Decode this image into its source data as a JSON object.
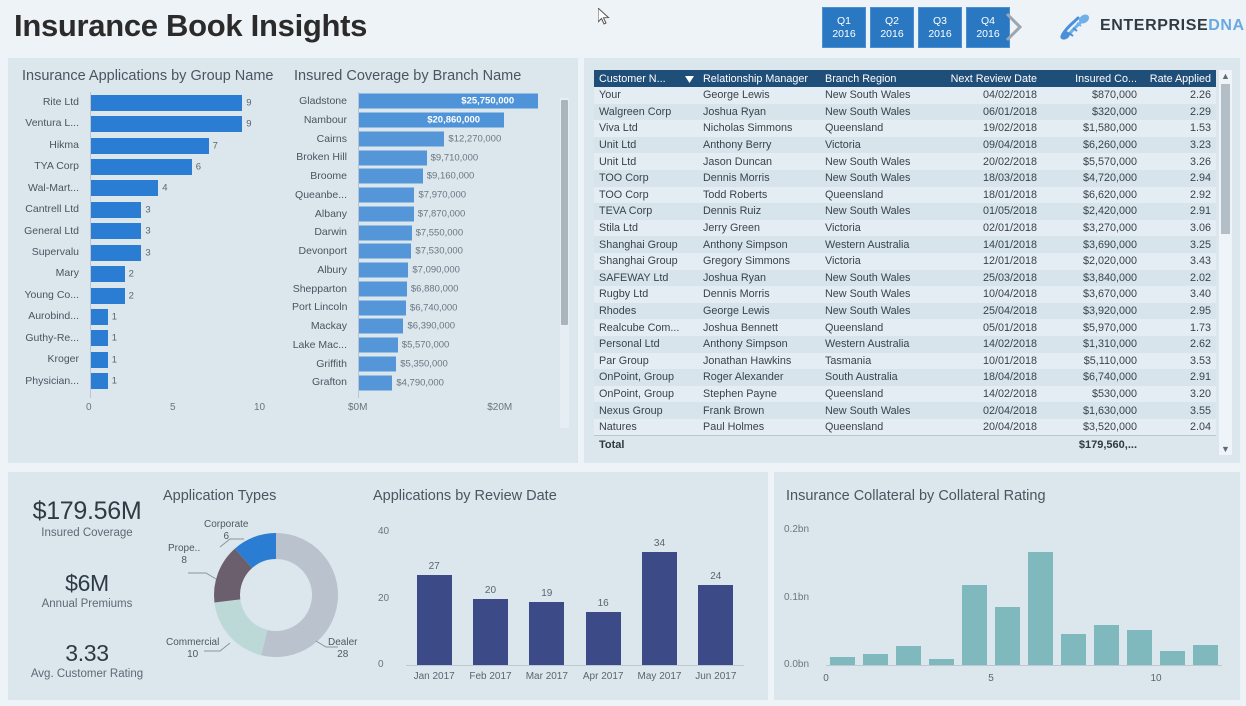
{
  "header": {
    "title": "Insurance Book Insights",
    "quarters": [
      {
        "q": "Q1",
        "year": "2016"
      },
      {
        "q": "Q2",
        "year": "2016"
      },
      {
        "q": "Q3",
        "year": "2016"
      },
      {
        "q": "Q4",
        "year": "2016"
      }
    ],
    "next_arrow": "next-quarter-arrow",
    "brand_primary": "ENTERPRISE",
    "brand_secondary": "DNA",
    "brand_color": "#69a8e0",
    "accent_color": "#2b78c2"
  },
  "panels": {
    "applications_title": "Insurance Applications by Group Name",
    "coverage_title": "Insured Coverage by Branch Name",
    "app_types_title": "Application Types",
    "review_date_title": "Applications by Review Date",
    "collateral_title": "Insurance Collateral by Collateral Rating"
  },
  "kpis": [
    {
      "value": "$179.56M",
      "label": "Insured Coverage"
    },
    {
      "value": "$6M",
      "label": "Annual Premiums"
    },
    {
      "value": "3.33",
      "label": "Avg. Customer Rating"
    }
  ],
  "table": {
    "headers": [
      "Customer N...",
      "Relationship Manager",
      "Branch Region",
      "Next Review Date",
      "Insured Co...",
      "Rate Applied"
    ],
    "sort_indicator": "sort-descending-icon",
    "rows": [
      [
        "Your",
        "George Lewis",
        "New South Wales",
        "04/02/2018",
        "$870,000",
        "2.26"
      ],
      [
        "Walgreen Corp",
        "Joshua Ryan",
        "New South Wales",
        "06/01/2018",
        "$320,000",
        "2.29"
      ],
      [
        "Viva Ltd",
        "Nicholas Simmons",
        "Queensland",
        "19/02/2018",
        "$1,580,000",
        "1.53"
      ],
      [
        "Unit Ltd",
        "Anthony Berry",
        "Victoria",
        "09/04/2018",
        "$6,260,000",
        "3.23"
      ],
      [
        "Unit Ltd",
        "Jason Duncan",
        "New South Wales",
        "20/02/2018",
        "$5,570,000",
        "3.26"
      ],
      [
        "TOO Corp",
        "Dennis Morris",
        "New South Wales",
        "18/03/2018",
        "$4,720,000",
        "2.94"
      ],
      [
        "TOO Corp",
        "Todd Roberts",
        "Queensland",
        "18/01/2018",
        "$6,620,000",
        "2.92"
      ],
      [
        "TEVA Corp",
        "Dennis Ruiz",
        "New South Wales",
        "01/05/2018",
        "$2,420,000",
        "2.91"
      ],
      [
        "Stila Ltd",
        "Jerry Green",
        "Victoria",
        "02/01/2018",
        "$3,270,000",
        "3.06"
      ],
      [
        "Shanghai Group",
        "Anthony Simpson",
        "Western Australia",
        "14/01/2018",
        "$3,690,000",
        "3.25"
      ],
      [
        "Shanghai Group",
        "Gregory Simmons",
        "Victoria",
        "12/01/2018",
        "$2,020,000",
        "3.43"
      ],
      [
        "SAFEWAY Ltd",
        "Joshua Ryan",
        "New South Wales",
        "25/03/2018",
        "$3,840,000",
        "2.02"
      ],
      [
        "Rugby Ltd",
        "Dennis Morris",
        "New South Wales",
        "10/04/2018",
        "$3,670,000",
        "3.40"
      ],
      [
        "Rhodes",
        "George Lewis",
        "New South Wales",
        "25/04/2018",
        "$3,920,000",
        "2.95"
      ],
      [
        "Realcube Com...",
        "Joshua Bennett",
        "Queensland",
        "05/01/2018",
        "$5,970,000",
        "1.73"
      ],
      [
        "Personal Ltd",
        "Anthony Simpson",
        "Western Australia",
        "14/02/2018",
        "$1,310,000",
        "2.62"
      ],
      [
        "Par Group",
        "Jonathan Hawkins",
        "Tasmania",
        "10/01/2018",
        "$5,110,000",
        "3.53"
      ],
      [
        "OnPoint, Group",
        "Roger Alexander",
        "South Australia",
        "18/04/2018",
        "$6,740,000",
        "2.91"
      ],
      [
        "OnPoint, Group",
        "Stephen Payne",
        "Queensland",
        "14/02/2018",
        "$530,000",
        "3.20"
      ],
      [
        "Nexus Group",
        "Frank Brown",
        "New South Wales",
        "02/04/2018",
        "$1,630,000",
        "3.55"
      ],
      [
        "Natures",
        "Paul Holmes",
        "Queensland",
        "20/04/2018",
        "$3,520,000",
        "2.04"
      ]
    ],
    "total_label": "Total",
    "total_value": "$179,560,..."
  },
  "chart_data": [
    {
      "type": "bar",
      "orientation": "horizontal",
      "title": "Insurance Applications by Group Name",
      "categories": [
        "Rite Ltd",
        "Ventura L...",
        "Hikma",
        "TYA Corp",
        "Wal-Mart...",
        "Cantrell Ltd",
        "General Ltd",
        "Supervalu",
        "Mary",
        "Young Co...",
        "Aurobind...",
        "Guthy-Re...",
        "Kroger",
        "Physician..."
      ],
      "values": [
        9,
        9,
        7,
        6,
        4,
        3,
        3,
        3,
        2,
        2,
        1,
        1,
        1,
        1
      ],
      "xlabel": "",
      "ylabel": "",
      "xlim": [
        0,
        10
      ],
      "xticks": [
        "0",
        "5",
        "10"
      ],
      "grid": false,
      "bar_color": "#2b7cd3"
    },
    {
      "type": "bar",
      "orientation": "horizontal",
      "title": "Insured Coverage by Branch Name",
      "categories": [
        "Gladstone",
        "Nambour",
        "Cairns",
        "Broken Hill",
        "Broome",
        "Queanbe...",
        "Albany",
        "Darwin",
        "Devonport",
        "Albury",
        "Shepparton",
        "Port Lincoln",
        "Mackay",
        "Lake Mac...",
        "Griffith",
        "Grafton"
      ],
      "values": [
        25750000,
        20860000,
        12270000,
        9710000,
        9160000,
        7970000,
        7870000,
        7550000,
        7530000,
        7090000,
        6880000,
        6740000,
        6390000,
        5570000,
        5350000,
        4790000
      ],
      "value_labels": [
        "$25,750,000",
        "$20,860,000",
        "$12,270,000",
        "$9,710,000",
        "$9,160,000",
        "$7,970,000",
        "$7,870,000",
        "$7,550,000",
        "$7,530,000",
        "$7,090,000",
        "$6,880,000",
        "$6,740,000",
        "$6,390,000",
        "$5,570,000",
        "$5,350,000",
        "$4,790,000"
      ],
      "xlim": [
        0,
        27000000
      ],
      "xticks": [
        "$0M",
        "$20M"
      ],
      "grid": false,
      "bar_color": "#5596d8"
    },
    {
      "type": "pie",
      "variant": "donut",
      "title": "Application Types",
      "labels": [
        "Dealer",
        "Commercial",
        "Prope..",
        "Corporate"
      ],
      "values": [
        28,
        10,
        8,
        6
      ],
      "colors": [
        "#b9c2cd",
        "#bcd9d8",
        "#6b5f6d",
        "#2b7cd3"
      ]
    },
    {
      "type": "bar",
      "orientation": "vertical",
      "title": "Applications by Review Date",
      "categories": [
        "Jan 2017",
        "Feb 2017",
        "Mar 2017",
        "Apr 2017",
        "May 2017",
        "Jun 2017"
      ],
      "values": [
        27,
        20,
        19,
        16,
        34,
        24
      ],
      "ylim": [
        0,
        40
      ],
      "yticks": [
        "0",
        "20",
        "40"
      ],
      "grid": false,
      "bar_color": "#3c4a87"
    },
    {
      "type": "bar",
      "orientation": "vertical",
      "title": "Insurance Collateral by Collateral Rating",
      "categories": [
        "1",
        "2",
        "3",
        "4",
        "5",
        "6",
        "7",
        "8",
        "9",
        "10",
        "11",
        "12"
      ],
      "values": [
        0.012,
        0.016,
        0.028,
        0.009,
        0.118,
        0.086,
        0.168,
        0.046,
        0.059,
        0.052,
        0.021,
        0.03
      ],
      "xlabel": "",
      "ylabel": "",
      "ylim": [
        0,
        0.2
      ],
      "yticks": [
        "0.0bn",
        "0.1bn",
        "0.2bn"
      ],
      "xticks": [
        "0",
        "5",
        "10"
      ],
      "grid": false,
      "bar_color": "#7fb8bd"
    }
  ]
}
